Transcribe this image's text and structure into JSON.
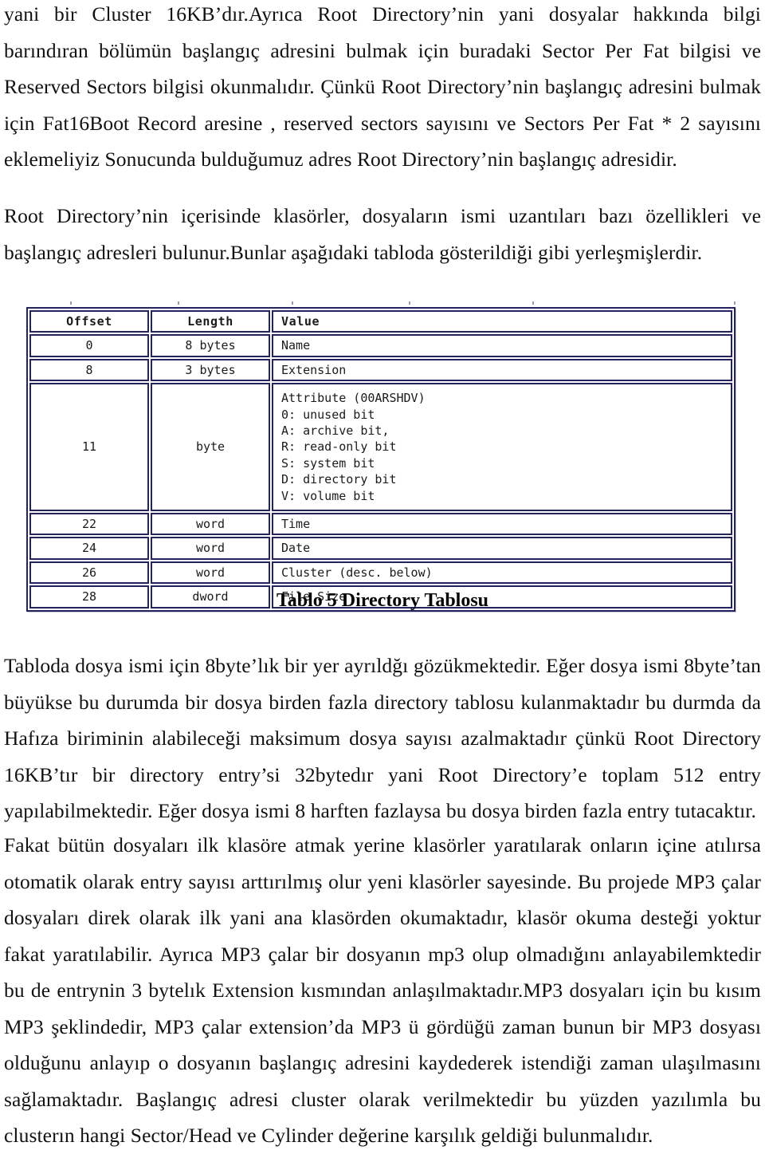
{
  "document": {
    "language": "tr",
    "paragraphs": [
      {
        "id": "p1",
        "text": "yani bir Cluster 16KB’dır.Ayrıca Root Directory’nin yani dosyalar hakkında bilgi barındıran bölümün başlangıç adresini bulmak için buradaki Sector Per Fat bilgisi ve Reserved Sectors bilgisi okunmalıdır. Çünkü  Root Directory’nin başlangıç adresini bulmak için Fat16Boot Record aresine , reserved sectors sayısını ve Sectors Per Fat * 2 sayısını eklemeliyiz Sonucunda bulduğumuz adres Root Directory’nin başlangıç adresidir."
      },
      {
        "id": "p2",
        "text": "Root Directory’nin içerisinde klasörler, dosyaların ismi uzantıları bazı özellikleri ve başlangıç adresleri bulunur.Bunlar aşağıdaki tabloda gösterildiği gibi yerleşmişlerdir."
      },
      {
        "id": "p3",
        "text": "Tabloda dosya ismi için 8byte’lık bir yer ayrıldğı gözükmektedir. Eğer dosya ismi 8byte’tan büyükse bu durumda bir dosya birden fazla directory tablosu kulanmaktadır bu durmda da Hafıza biriminin alabileceği maksimum dosya sayısı azalmaktadır çünkü Root Directory 16KB’tır bir directory entry’si 32bytedır yani Root Directory’e toplam 512 entry yapılabilmektedir. Eğer dosya ismi 8 harften fazlaysa bu dosya birden fazla entry tutacaktır."
      },
      {
        "id": "p4",
        "text": "Fakat bütün dosyaları ilk klasöre atmak yerine klasörler yaratılarak onların içine atılırsa otomatik olarak entry sayısı arttırılmış olur yeni klasörler sayesinde. Bu projede MP3 çalar dosyaları direk olarak ilk yani ana klasörden okumaktadır, klasör okuma desteği yoktur fakat yaratılabilir. Ayrıca MP3 çalar bir dosyanın mp3 olup olmadığını anlayabilemktedir bu de entrynin 3 bytelık Extension kısmından anlaşılmaktadır.MP3 dosyaları için bu kısım MP3 şeklindedir, MP3 çalar extension’da MP3 ü gördüğü zaman bunun bir MP3 dosyası olduğunu anlayıp o dosyanın başlangıç adresini kaydederek istendiği zaman ulaşılmasını sağlamaktadır. Başlangıç adresi cluster olarak verilmektedir bu yüzden yazılımla bu clusterın hangi Sector/Head ve Cylinder değerine karşılık geldiği bulunmalıdır."
      }
    ]
  },
  "figure": {
    "caption": "Tablo 5 Directory Tablosu",
    "border_color": "#23235e",
    "background_color": "#ffffff",
    "columns": [
      "Offset",
      "Length",
      "Value"
    ],
    "rows": [
      {
        "offset": "0",
        "length": "8 bytes",
        "value": "Name"
      },
      {
        "offset": "8",
        "length": "3 bytes",
        "value": "Extension"
      },
      {
        "offset": "11",
        "length": "byte",
        "value": "Attribute (00ARSHDV)\n0: unused bit\nA: archive bit,\nR: read-only bit\nS: system bit\nD: directory bit\nV: volume bit"
      },
      {
        "offset": "22",
        "length": "word",
        "value": "Time"
      },
      {
        "offset": "24",
        "length": "word",
        "value": "Date"
      },
      {
        "offset": "26",
        "length": "word",
        "value": "Cluster (desc. below)"
      },
      {
        "offset": "28",
        "length": "dword",
        "value": "File Size"
      }
    ]
  }
}
